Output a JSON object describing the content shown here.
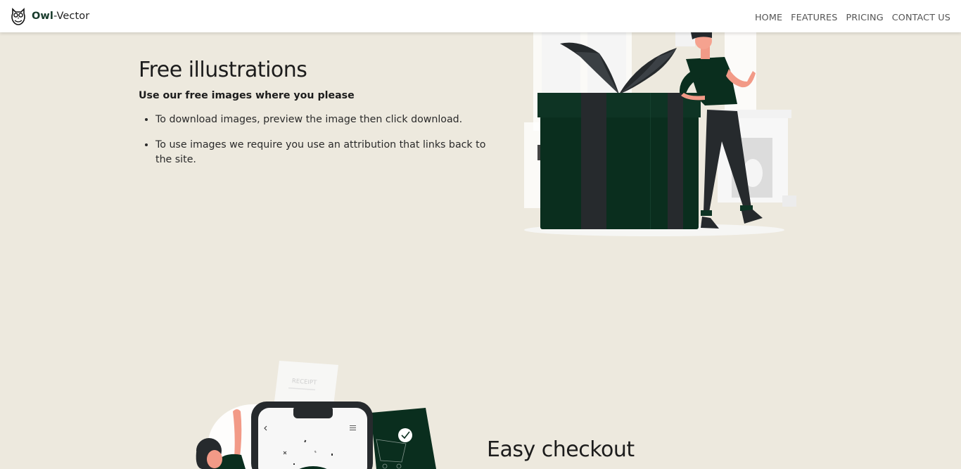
{
  "brand": {
    "name_bold": "Owl",
    "name_rest": "-Vector",
    "logo_icon": "owl-logo-icon"
  },
  "nav": {
    "items": [
      "HOME",
      "FEATURES",
      "PRICING",
      "CONTACT US"
    ]
  },
  "hero": {
    "title": "Free illustrations",
    "subtitle": "Use our free images where you please",
    "bullets": [
      "To download images, preview the image then click download.",
      "To use images we require you use an attribution that links back to the site."
    ]
  },
  "illustration_gift": {
    "icon": "gift-illustration"
  },
  "illustration_checkout": {
    "icon": "phone-checkout-illustration",
    "receipt_label": "RECEIPT"
  },
  "checkout": {
    "title": "Easy checkout"
  },
  "colors": {
    "page_bg": "#ede9de",
    "accent": "#173a2b",
    "dark": "#262a2d"
  }
}
